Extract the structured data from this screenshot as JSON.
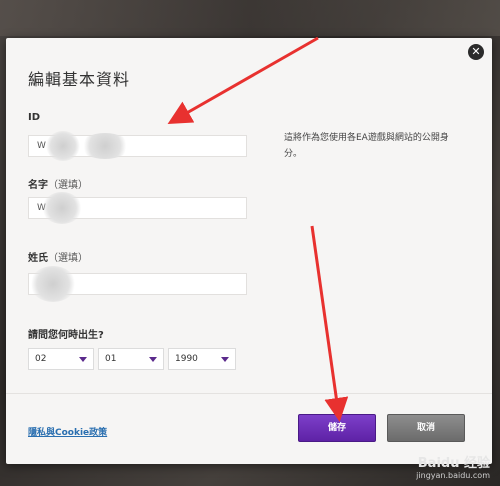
{
  "dialog": {
    "title": "編輯基本資料",
    "id_label": "ID",
    "id_value": "W",
    "id_hint": "這將作為您使用各EA遊戲與網站的公開身分。",
    "first_name_label": "名字",
    "first_name_hint": "（選填）",
    "first_name_value": "W",
    "last_name_label": "姓氏",
    "last_name_hint": "（選填）",
    "last_name_value": "",
    "birth_label": "請問您何時出生?",
    "birth_month": "02",
    "birth_day": "01",
    "birth_year": "1990",
    "privacy_link": "隱私與Cookie政策",
    "save_button": "儲存",
    "cancel_button": "取消"
  },
  "colors": {
    "primary": "#6a2db6",
    "link": "#2a6fb0",
    "annotation_arrow": "#e8312f"
  },
  "watermark": {
    "brand": "Baidu 经验",
    "url": "jingyan.baidu.com"
  }
}
